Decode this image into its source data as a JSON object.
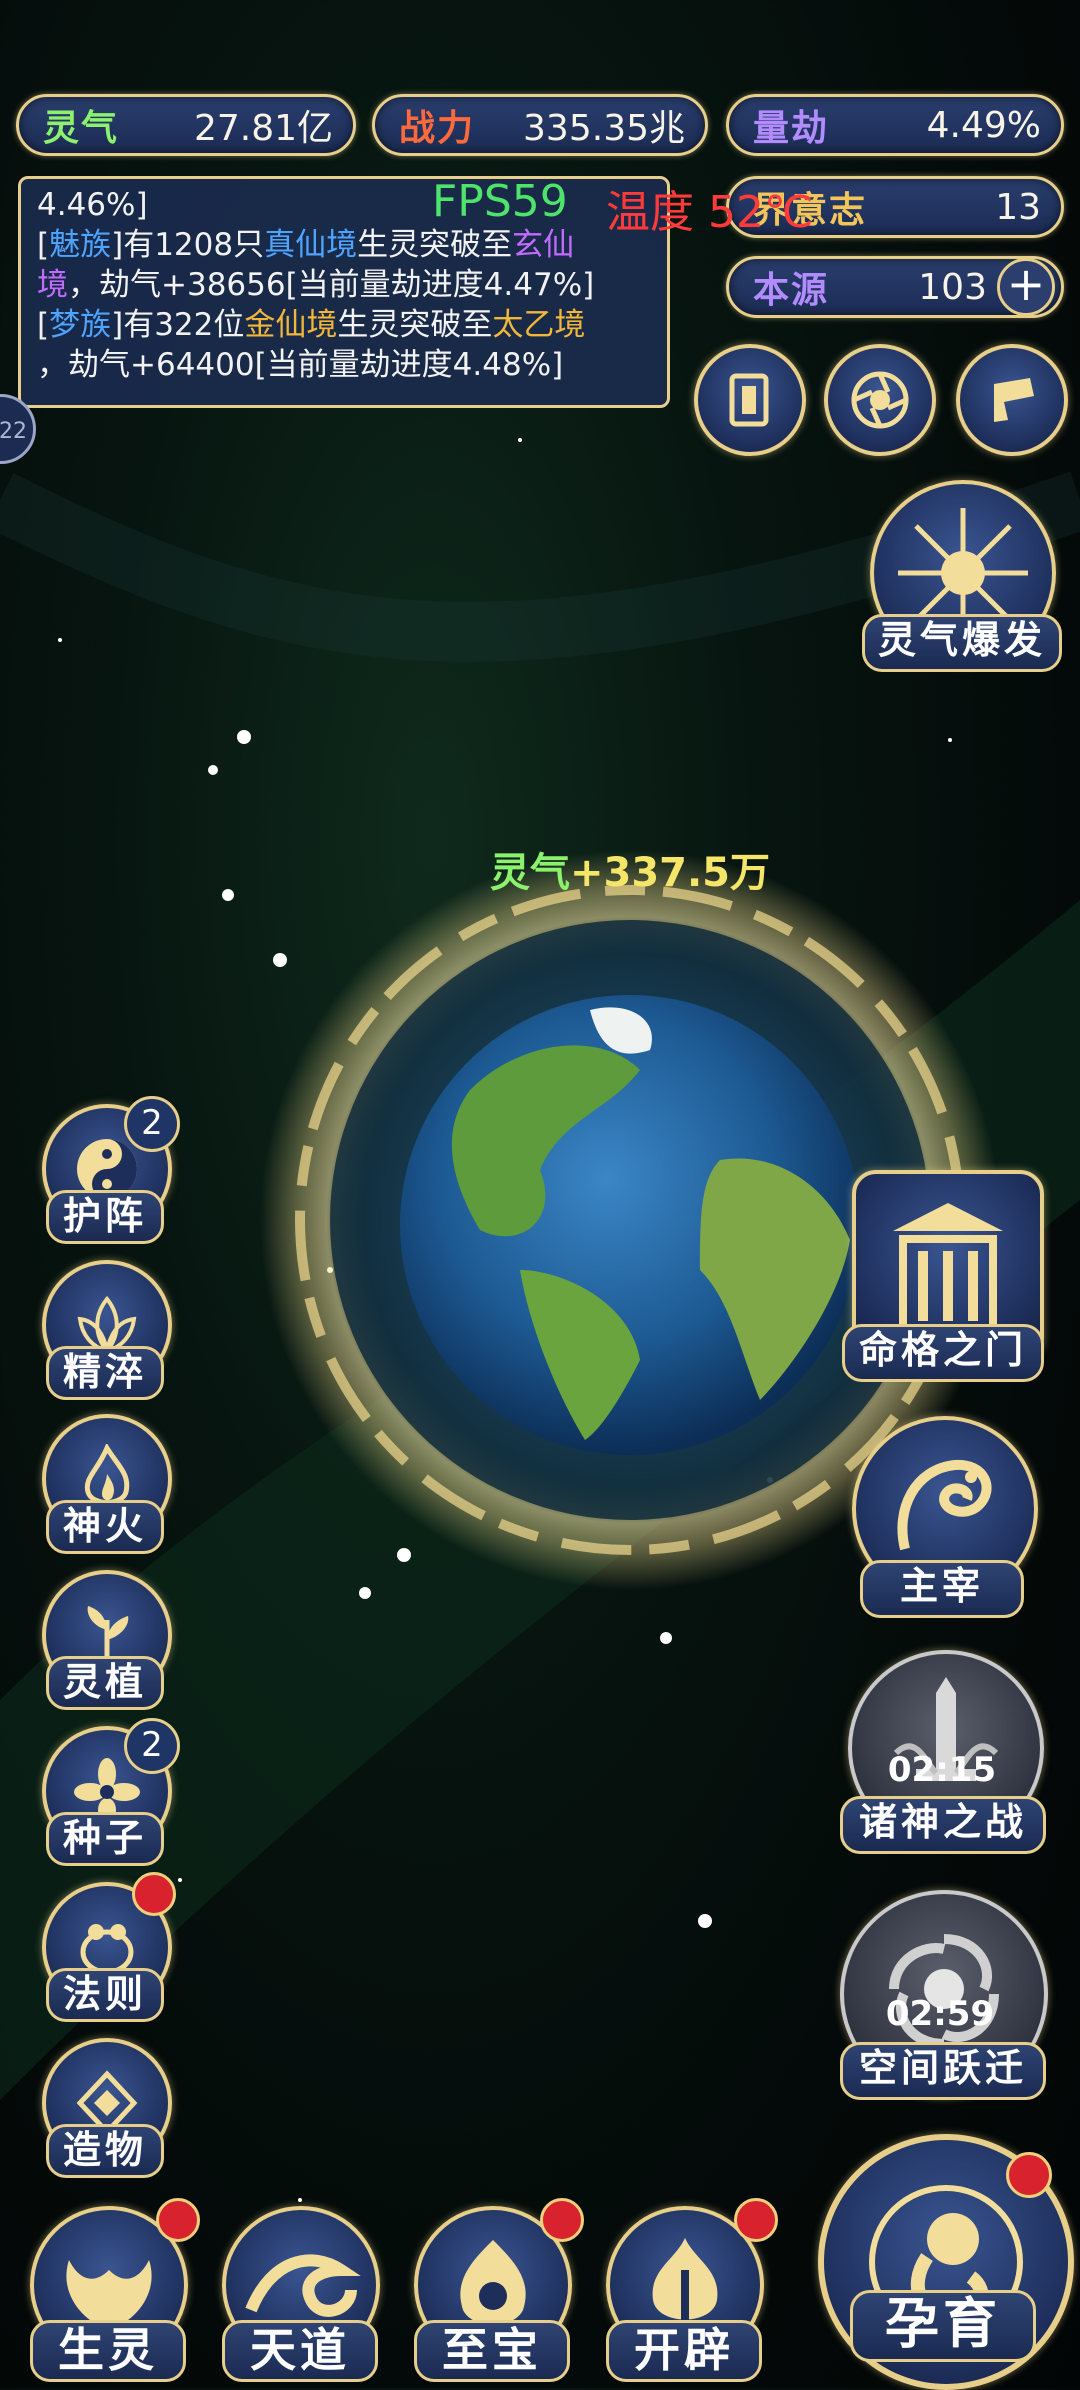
{
  "stats": {
    "lingqi": {
      "label": "灵气",
      "value": "27.81亿"
    },
    "zhanli": {
      "label": "战力",
      "value": "335.35兆"
    },
    "liangjie": {
      "label": "量劫",
      "value": "4.49%"
    },
    "yizhi": {
      "label": "界意志",
      "value": "13"
    },
    "benyuan": {
      "label": "本源",
      "value": "103"
    }
  },
  "overlay": {
    "fps": "FPS59",
    "temp": "温度 52℃"
  },
  "log": {
    "line0": "4.46%]",
    "e1": {
      "b1": "[",
      "race": "魅族",
      "b2": "]有1208只",
      "realm1": "真仙境",
      "mid": "生灵突破至",
      "realm2a": "玄仙",
      "realm2b": "境",
      "tail": "，劫气+38656[当前量劫进度4.47%]"
    },
    "e2": {
      "b1": "[",
      "race": "梦族",
      "b2": "]有322位",
      "realm1": "金仙境",
      "mid": "生灵突破至",
      "realm2": "太乙境",
      "tail": "，劫气+64400[当前量劫进度4.48%]"
    }
  },
  "edge_badge": "22",
  "burst": {
    "label": "灵气爆发"
  },
  "float": {
    "prefix": "灵气",
    "value": "+337.5万"
  },
  "left_menu": [
    {
      "label": "护阵",
      "badge": "2",
      "icon": "yin-yang-icon"
    },
    {
      "label": "精淬",
      "icon": "lotus-icon"
    },
    {
      "label": "神火",
      "icon": "flame-icon"
    },
    {
      "label": "灵植",
      "icon": "plant-icon"
    },
    {
      "label": "种子",
      "badge": "2",
      "icon": "seed-flower-icon"
    },
    {
      "label": "法则",
      "icon": "frog-icon"
    },
    {
      "label": "造物",
      "icon": "diamond-icon"
    }
  ],
  "right_menu": {
    "gate": "命格之门",
    "master": "主宰",
    "war": {
      "label": "诸神之战",
      "timer": "02:15"
    },
    "leap": {
      "label": "空间跃迁",
      "timer": "02:59"
    }
  },
  "bottom_nav": [
    "生灵",
    "天道",
    "至宝",
    "开辟"
  ],
  "breed": "孕育",
  "colors": {
    "gold": "#e7cf8a",
    "panel": "#1d2e5a",
    "fps": "#4ee36a",
    "temp": "#ff3a3a",
    "alert": "#d8222e"
  }
}
